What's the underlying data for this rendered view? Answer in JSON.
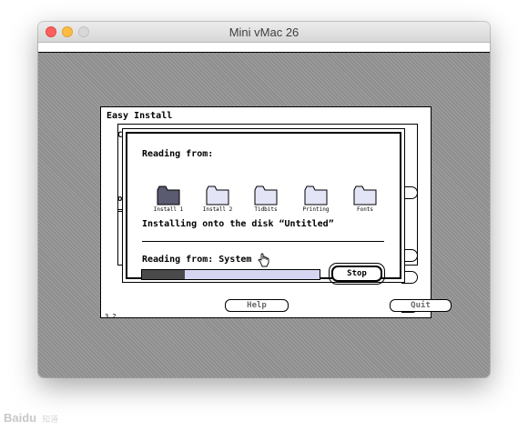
{
  "window": {
    "title": "Mini vMac 26",
    "controls": {
      "close": "#fc605c",
      "minimize": "#fdbc40",
      "zoom": "#d8d8d8"
    }
  },
  "easy_install": {
    "title": "Easy Install",
    "fragment_c": "C",
    "fragment_o": "o",
    "version": "3.2",
    "buttons": {
      "help": "Help",
      "quit": "Quit"
    }
  },
  "progress_dialog": {
    "reading_label": "Reading from:",
    "disks": [
      {
        "label": "Install 1",
        "active": true,
        "icon": "folder-icon"
      },
      {
        "label": "Install 2",
        "active": false,
        "icon": "folder-icon"
      },
      {
        "label": "Tidbits",
        "active": false,
        "icon": "folder-icon"
      },
      {
        "label": "Printing",
        "active": false,
        "icon": "folder-icon"
      },
      {
        "label": "Fonts",
        "active": false,
        "icon": "folder-icon"
      }
    ],
    "target_text": "Installing onto the disk “Untitled”",
    "status_text": "Reading from: System",
    "progress": 0.24,
    "stop_label": "Stop",
    "cursor_icon": "hand-pointer-icon",
    "colors": {
      "progress_fill": "#4a4a4a",
      "progress_track": "#d6d6f2",
      "active_folder": "#5a5a70",
      "folder": "#e4e4f7"
    }
  },
  "watermark": {
    "brand": "Bai",
    "paw": "du",
    "chinese": "知道"
  }
}
